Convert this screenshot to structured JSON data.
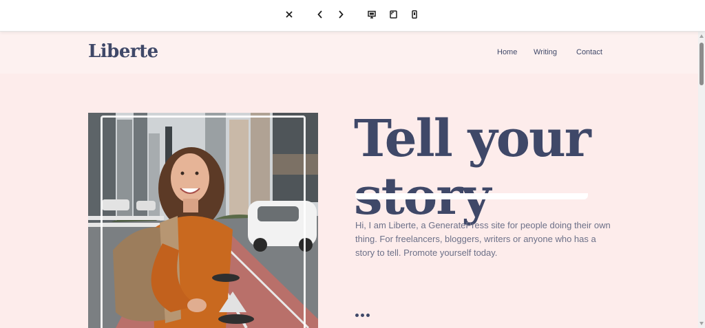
{
  "toolbar": {
    "icons": [
      "close-icon",
      "chevron-left-icon",
      "chevron-right-icon",
      "desktop-icon",
      "tablet-icon",
      "mobile-icon"
    ]
  },
  "site": {
    "logo": "Liberte",
    "nav": [
      "Home",
      "Writing",
      "Contact"
    ],
    "hero": {
      "title_line1": "Tell your",
      "title_line2": "story",
      "text": "Hi, I am Liberte, a GeneratePress site for people doing their own thing. For freelancers, bloggers, writers or anyone who has a story to tell. Promote yourself today.",
      "more": "•••"
    }
  },
  "colors": {
    "background": "#fdeceb",
    "header": "#fdf1f0",
    "heading": "#3f4868",
    "body_text": "#6c7088"
  }
}
